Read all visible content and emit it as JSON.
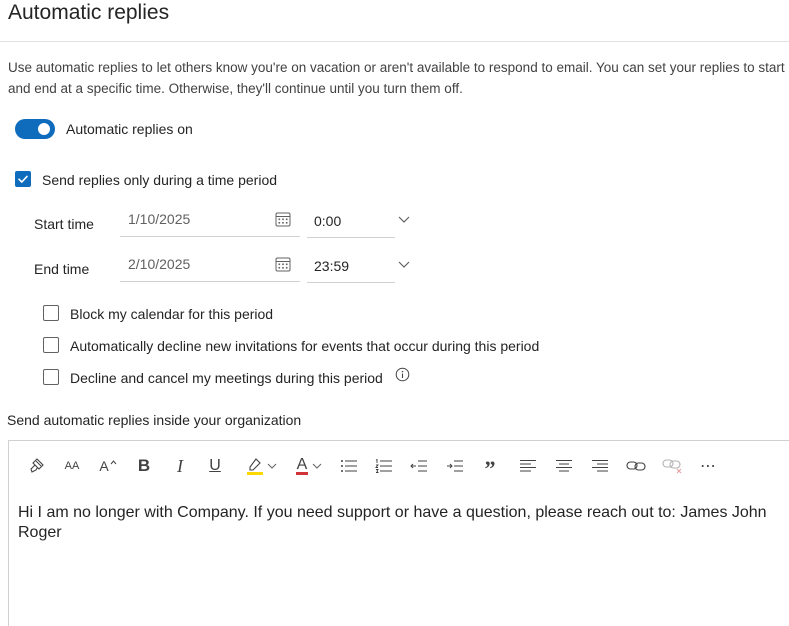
{
  "page": {
    "title": "Automatic replies",
    "description": "Use automatic replies to let others know you're on vacation or aren't available to respond to email. You can set your replies to start and end at a specific time. Otherwise, they'll continue until you turn them off."
  },
  "toggle": {
    "label": "Automatic replies on",
    "state": "on"
  },
  "time_period": {
    "checkbox_label": "Send replies only during a time period",
    "checked": true,
    "start": {
      "label": "Start time",
      "date": "1/10/2025",
      "time": "0:00"
    },
    "end": {
      "label": "End time",
      "date": "2/10/2025",
      "time": "23:59"
    }
  },
  "options": [
    {
      "label": "Block my calendar for this period",
      "checked": false
    },
    {
      "label": "Automatically decline new invitations for events that occur during this period",
      "checked": false
    },
    {
      "label": "Decline and cancel my meetings during this period",
      "checked": false
    }
  ],
  "inside_org": {
    "heading": "Send automatic replies inside your organization"
  },
  "editor": {
    "text": "Hi I am no longer with Company. If you need support or have a question, please reach out to: James John Roger",
    "toolbar": {
      "font_size_glyph": "AA",
      "grow_font_glyph": "A",
      "bold_glyph": "B",
      "italic_glyph": "I",
      "underline_glyph": "U",
      "font_color_glyph": "A",
      "quote_glyph": "”",
      "more_glyph": "⋯"
    }
  },
  "colors": {
    "accent": "#0f6cbd",
    "highlight": "#ffd800",
    "font_color": "#d13438"
  },
  "icons": [
    "calendar-icon",
    "chevron-down-icon",
    "info-icon",
    "format-painter-icon",
    "bullets-icon",
    "numbering-icon",
    "indent-icon",
    "outdent-icon",
    "align-left-icon",
    "align-center-icon",
    "align-right-icon",
    "link-icon",
    "remove-link-icon"
  ]
}
